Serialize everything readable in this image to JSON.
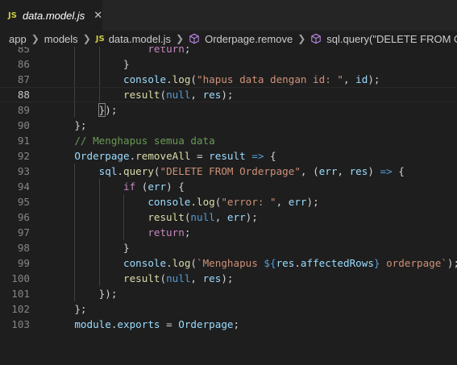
{
  "tab": {
    "badge": "JS",
    "title": "data.model.js",
    "close": "✕"
  },
  "breadcrumb": {
    "items": [
      {
        "label": "app"
      },
      {
        "label": "models"
      },
      {
        "label": "data.model.js",
        "badge": "JS"
      },
      {
        "label": "Orderpage.remove"
      },
      {
        "label": "sql.query(\"DELETE FROM Order"
      }
    ]
  },
  "editor": {
    "lines": [
      {
        "n": "85",
        "tokens": [
          [
            "",
            "                "
          ],
          [
            "kw",
            "return"
          ],
          [
            "op",
            ";"
          ]
        ]
      },
      {
        "n": "86",
        "tokens": [
          [
            "",
            "            }"
          ]
        ]
      },
      {
        "n": "87",
        "tokens": [
          [
            "var",
            "            console"
          ],
          [
            "op",
            "."
          ],
          [
            "fn",
            "log"
          ],
          [
            "op",
            "("
          ],
          [
            "str",
            "\"hapus data dengan id: \""
          ],
          [
            "op",
            ", "
          ],
          [
            "var",
            "id"
          ],
          [
            "op",
            ");"
          ]
        ]
      },
      {
        "n": "88",
        "tokens": [
          [
            "fn",
            "            result"
          ],
          [
            "op",
            "("
          ],
          [
            "kc",
            "null"
          ],
          [
            "op",
            ", "
          ],
          [
            "var",
            "res"
          ],
          [
            "op",
            ");"
          ]
        ]
      },
      {
        "n": "89",
        "tokens": [
          [
            "",
            "        "
          ],
          [
            "box",
            "}"
          ],
          [
            "op",
            ");"
          ]
        ]
      },
      {
        "n": "90",
        "tokens": [
          [
            "",
            "    };"
          ]
        ]
      },
      {
        "n": "91",
        "tokens": [
          [
            "cm",
            "    // Menghapus semua data"
          ]
        ]
      },
      {
        "n": "92",
        "tokens": [
          [
            "var",
            "    Orderpage"
          ],
          [
            "op",
            "."
          ],
          [
            "fn",
            "removeAll"
          ],
          [
            "op",
            " = "
          ],
          [
            "var",
            "result"
          ],
          [
            "kc",
            " => "
          ],
          [
            "op",
            "{"
          ]
        ]
      },
      {
        "n": "93",
        "tokens": [
          [
            "var",
            "        sql"
          ],
          [
            "op",
            "."
          ],
          [
            "fn",
            "query"
          ],
          [
            "op",
            "("
          ],
          [
            "str",
            "\"DELETE FROM Orderpage\""
          ],
          [
            "op",
            ", ("
          ],
          [
            "var",
            "err"
          ],
          [
            "op",
            ", "
          ],
          [
            "var",
            "res"
          ],
          [
            "op",
            ")"
          ],
          [
            "kc",
            " => "
          ],
          [
            "op",
            "{"
          ]
        ]
      },
      {
        "n": "94",
        "tokens": [
          [
            "kw",
            "            if"
          ],
          [
            "op",
            " ("
          ],
          [
            "var",
            "err"
          ],
          [
            "op",
            ") {"
          ]
        ]
      },
      {
        "n": "95",
        "tokens": [
          [
            "var",
            "                console"
          ],
          [
            "op",
            "."
          ],
          [
            "fn",
            "log"
          ],
          [
            "op",
            "("
          ],
          [
            "str",
            "\"error: \""
          ],
          [
            "op",
            ", "
          ],
          [
            "var",
            "err"
          ],
          [
            "op",
            ");"
          ]
        ]
      },
      {
        "n": "96",
        "tokens": [
          [
            "fn",
            "                result"
          ],
          [
            "op",
            "("
          ],
          [
            "kc",
            "null"
          ],
          [
            "op",
            ", "
          ],
          [
            "var",
            "err"
          ],
          [
            "op",
            ");"
          ]
        ]
      },
      {
        "n": "97",
        "tokens": [
          [
            "kw",
            "                return"
          ],
          [
            "op",
            ";"
          ]
        ]
      },
      {
        "n": "98",
        "tokens": [
          [
            "",
            "            }"
          ]
        ]
      },
      {
        "n": "99",
        "tokens": [
          [
            "var",
            "            console"
          ],
          [
            "op",
            "."
          ],
          [
            "fn",
            "log"
          ],
          [
            "op",
            "("
          ],
          [
            "str",
            "`Menghapus "
          ],
          [
            "tpl",
            "${"
          ],
          [
            "var",
            "res"
          ],
          [
            "op",
            "."
          ],
          [
            "var",
            "affectedRows"
          ],
          [
            "tpl",
            "}"
          ],
          [
            "str",
            " orderpage`"
          ],
          [
            "op",
            ");"
          ]
        ]
      },
      {
        "n": "100",
        "tokens": [
          [
            "fn",
            "            result"
          ],
          [
            "op",
            "("
          ],
          [
            "kc",
            "null"
          ],
          [
            "op",
            ", "
          ],
          [
            "var",
            "res"
          ],
          [
            "op",
            ");"
          ]
        ]
      },
      {
        "n": "101",
        "tokens": [
          [
            "",
            "        });"
          ]
        ]
      },
      {
        "n": "102",
        "tokens": [
          [
            "",
            "    };"
          ]
        ]
      },
      {
        "n": "103",
        "tokens": [
          [
            "var",
            "    module"
          ],
          [
            "op",
            "."
          ],
          [
            "var",
            "exports"
          ],
          [
            "op",
            " = "
          ],
          [
            "var",
            "Orderpage"
          ],
          [
            "op",
            ";"
          ]
        ]
      }
    ],
    "active_line": "88",
    "colors": {
      "keyword": "#c586c0",
      "function": "#dcdcaa",
      "variable": "#9cdcfe",
      "string": "#ce9178",
      "comment": "#6a9955",
      "constant": "#569cd6"
    }
  }
}
